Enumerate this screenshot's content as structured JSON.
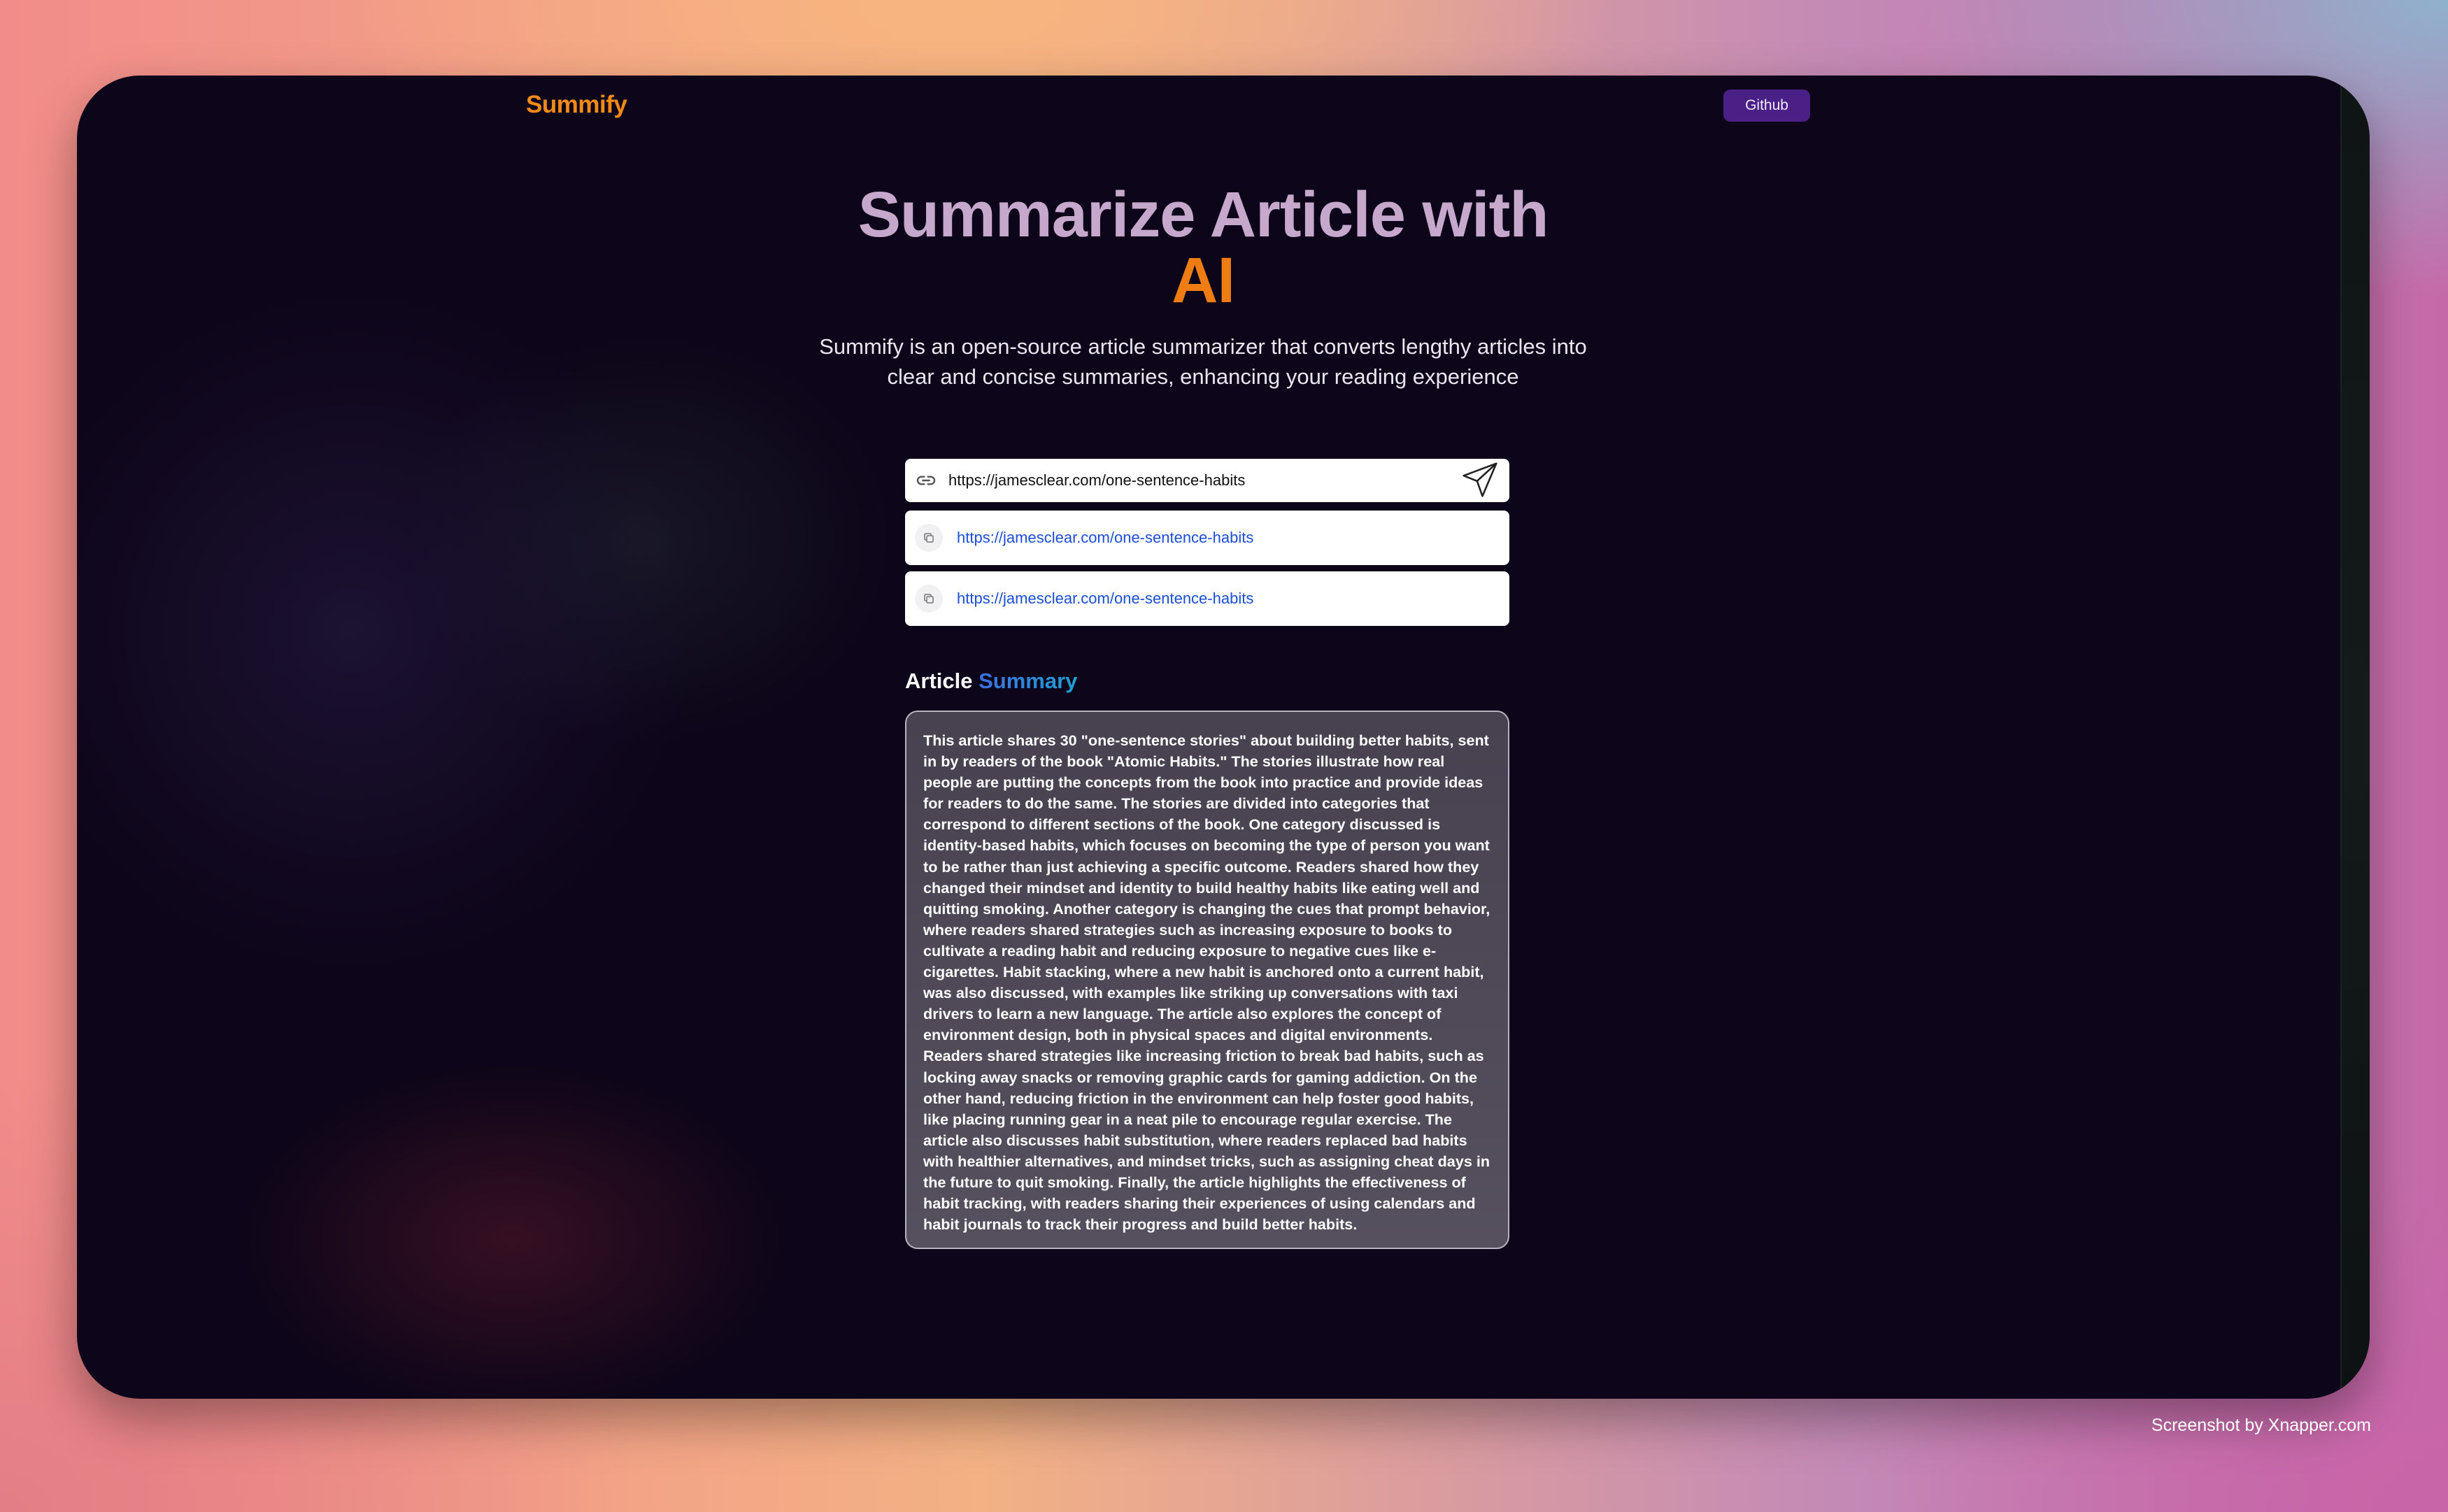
{
  "nav": {
    "logo": "Summify",
    "github_label": "Github"
  },
  "hero": {
    "title_main": "Summarize Article with",
    "title_accent": "AI",
    "subtitle": "Summify is an open-source article summarizer that converts lengthy articles into clear and concise summaries, enhancing your reading experience"
  },
  "form": {
    "url_value": "https://jamesclear.com/one-sentence-habits",
    "link_icon": "link-icon",
    "submit_icon": "paper-plane-icon"
  },
  "history": [
    {
      "url": "https://jamesclear.com/one-sentence-habits",
      "icon": "copy-icon"
    },
    {
      "url": "https://jamesclear.com/one-sentence-habits",
      "icon": "copy-icon"
    }
  ],
  "summary": {
    "heading_prefix": "Article",
    "heading_accent": "Summary",
    "text": "This article shares 30 \"one-sentence stories\" about building better habits, sent in by readers of the book \"Atomic Habits.\" The stories illustrate how real people are putting the concepts from the book into practice and provide ideas for readers to do the same. The stories are divided into categories that correspond to different sections of the book. One category discussed is identity-based habits, which focuses on becoming the type of person you want to be rather than just achieving a specific outcome. Readers shared how they changed their mindset and identity to build healthy habits like eating well and quitting smoking. Another category is changing the cues that prompt behavior, where readers shared strategies such as increasing exposure to books to cultivate a reading habit and reducing exposure to negative cues like e-cigarettes. Habit stacking, where a new habit is anchored onto a current habit, was also discussed, with examples like striking up conversations with taxi drivers to learn a new language. The article also explores the concept of environment design, both in physical spaces and digital environments. Readers shared strategies like increasing friction to break bad habits, such as locking away snacks or removing graphic cards for gaming addiction. On the other hand, reducing friction in the environment can help foster good habits, like placing running gear in a neat pile to encourage regular exercise. The article also discusses habit substitution, where readers replaced bad habits with healthier alternatives, and mindset tricks, such as assigning cheat days in the future to quit smoking. Finally, the article highlights the effectiveness of habit tracking, with readers sharing their experiences of using calendars and habit journals to track their progress and build better habits."
  },
  "footer": {
    "watermark": "Screenshot by Xnapper.com"
  },
  "colors": {
    "brand_orange": "#f28a16",
    "title_lilac": "#c6a8cc",
    "github_purple": "#4a1f86",
    "link_blue": "#1d4ed8",
    "page_bg": "#0d0519"
  }
}
